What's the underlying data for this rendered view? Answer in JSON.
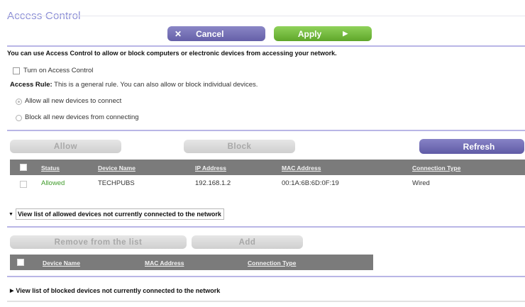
{
  "page": {
    "title": "Access Control",
    "cancel_label": "Cancel",
    "cancel_icon": "x-icon",
    "apply_label": "Apply",
    "apply_icon": "arrow-right-icon",
    "intro_text": "You can use Access Control to allow or block computers or electronic devices from accessing your network.",
    "turn_on_label": "Turn on Access Control",
    "turn_on_checked": false,
    "access_rule_label": "Access Rule:",
    "access_rule_text": "This is a general rule. You can also allow or block individual devices.",
    "rule_options": [
      {
        "label": "Allow all new devices to connect",
        "selected": true
      },
      {
        "label": "Block all new devices from connecting",
        "selected": false
      }
    ]
  },
  "device_table": {
    "allow_label": "Allow",
    "block_label": "Block",
    "refresh_label": "Refresh",
    "columns": [
      "Status",
      "Device Name",
      "IP Address",
      "MAC Address",
      "Connection Type"
    ],
    "rows": [
      {
        "status": "Allowed",
        "device_name": "TECHPUBS",
        "ip": "192.168.1.2",
        "mac": "00:1A:6B:6D:0F:19",
        "connection": "Wired"
      }
    ]
  },
  "allowed_not_connected": {
    "toggle_label": "View list of allowed devices not currently connected to the network",
    "expanded": true,
    "remove_label": "Remove from the list",
    "add_label": "Add",
    "columns": [
      "Device Name",
      "MAC Address",
      "Connection Type"
    ]
  },
  "blocked_not_connected": {
    "toggle_label": "View list of blocked devices not currently connected to the network",
    "expanded": false
  },
  "colors": {
    "accent_purple": "#6f6ab6",
    "apply_green": "#6cb536",
    "allowed_green": "#3f9b2a",
    "header_grey": "#7b7b7b"
  }
}
